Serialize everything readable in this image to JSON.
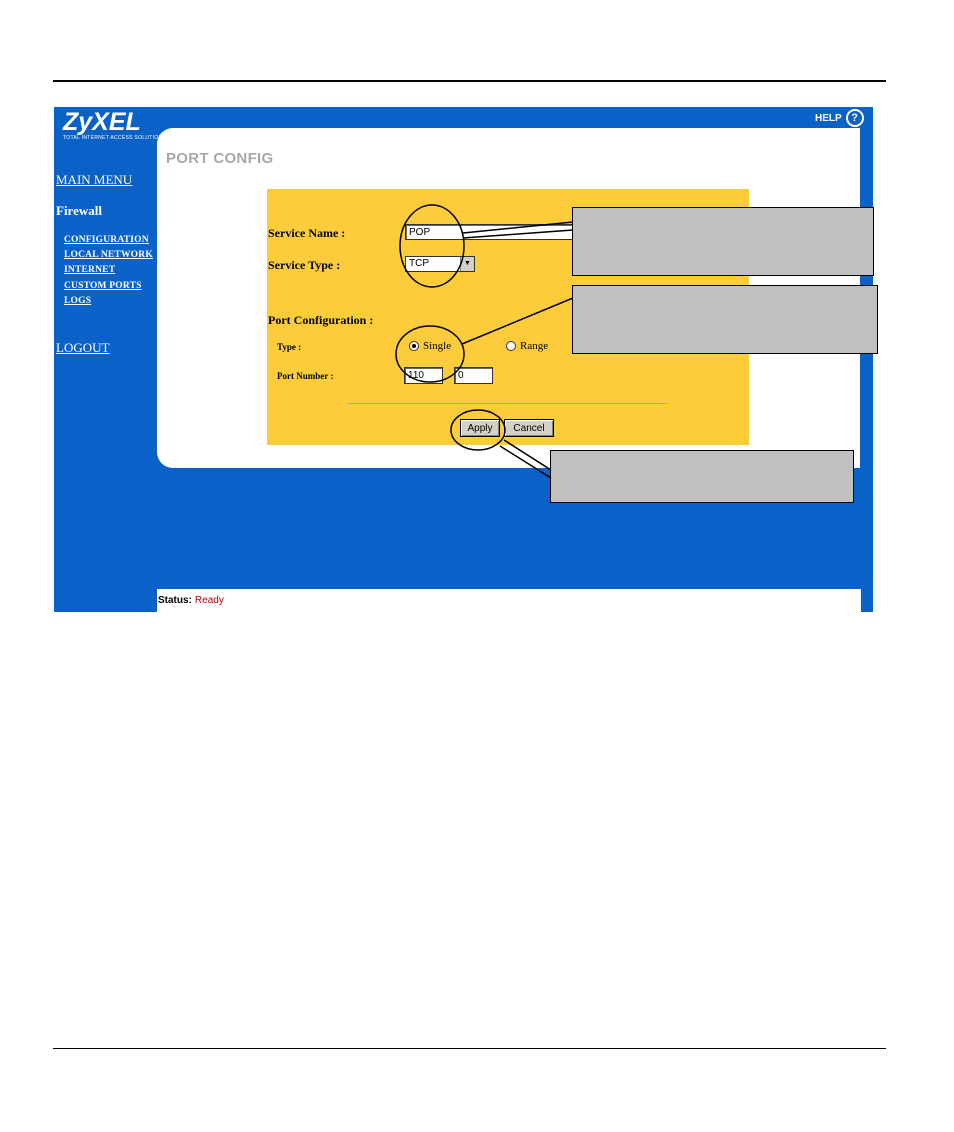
{
  "logo": {
    "brand": "ZyXEL",
    "tagline": "TOTAL INTERNET ACCESS SOLUTION"
  },
  "help": {
    "label": "HELP",
    "icon": "question-circle-icon"
  },
  "nav": {
    "main_menu": "MAIN MENU",
    "section": "Firewall",
    "items": [
      "CONFIGURATION",
      "LOCAL NETWORK",
      "INTERNET",
      "CUSTOM PORTS",
      "LOGS"
    ],
    "logout": "LOGOUT"
  },
  "page": {
    "title": "PORT CONFIG"
  },
  "form": {
    "service_name_label": "Service Name :",
    "service_name_value": "POP",
    "service_type_label": "Service Type :",
    "service_type_value": "TCP",
    "port_config_label": "Port Configuration :",
    "type_label": "Type :",
    "type_options": [
      {
        "label": "Single",
        "selected": true
      },
      {
        "label": "Range",
        "selected": false
      }
    ],
    "port_number_label": "Port Number :",
    "port_start": "110",
    "port_end": "0",
    "apply_label": "Apply",
    "cancel_label": "Cancel"
  },
  "status": {
    "label": "Status:",
    "value": "Ready"
  },
  "colors": {
    "nav_blue": "#0a62c9",
    "form_yellow": "#fdcc3a",
    "callout_gray": "#c0c0c0",
    "status_red": "#c00000",
    "title_gray": "#a8a8a8"
  }
}
